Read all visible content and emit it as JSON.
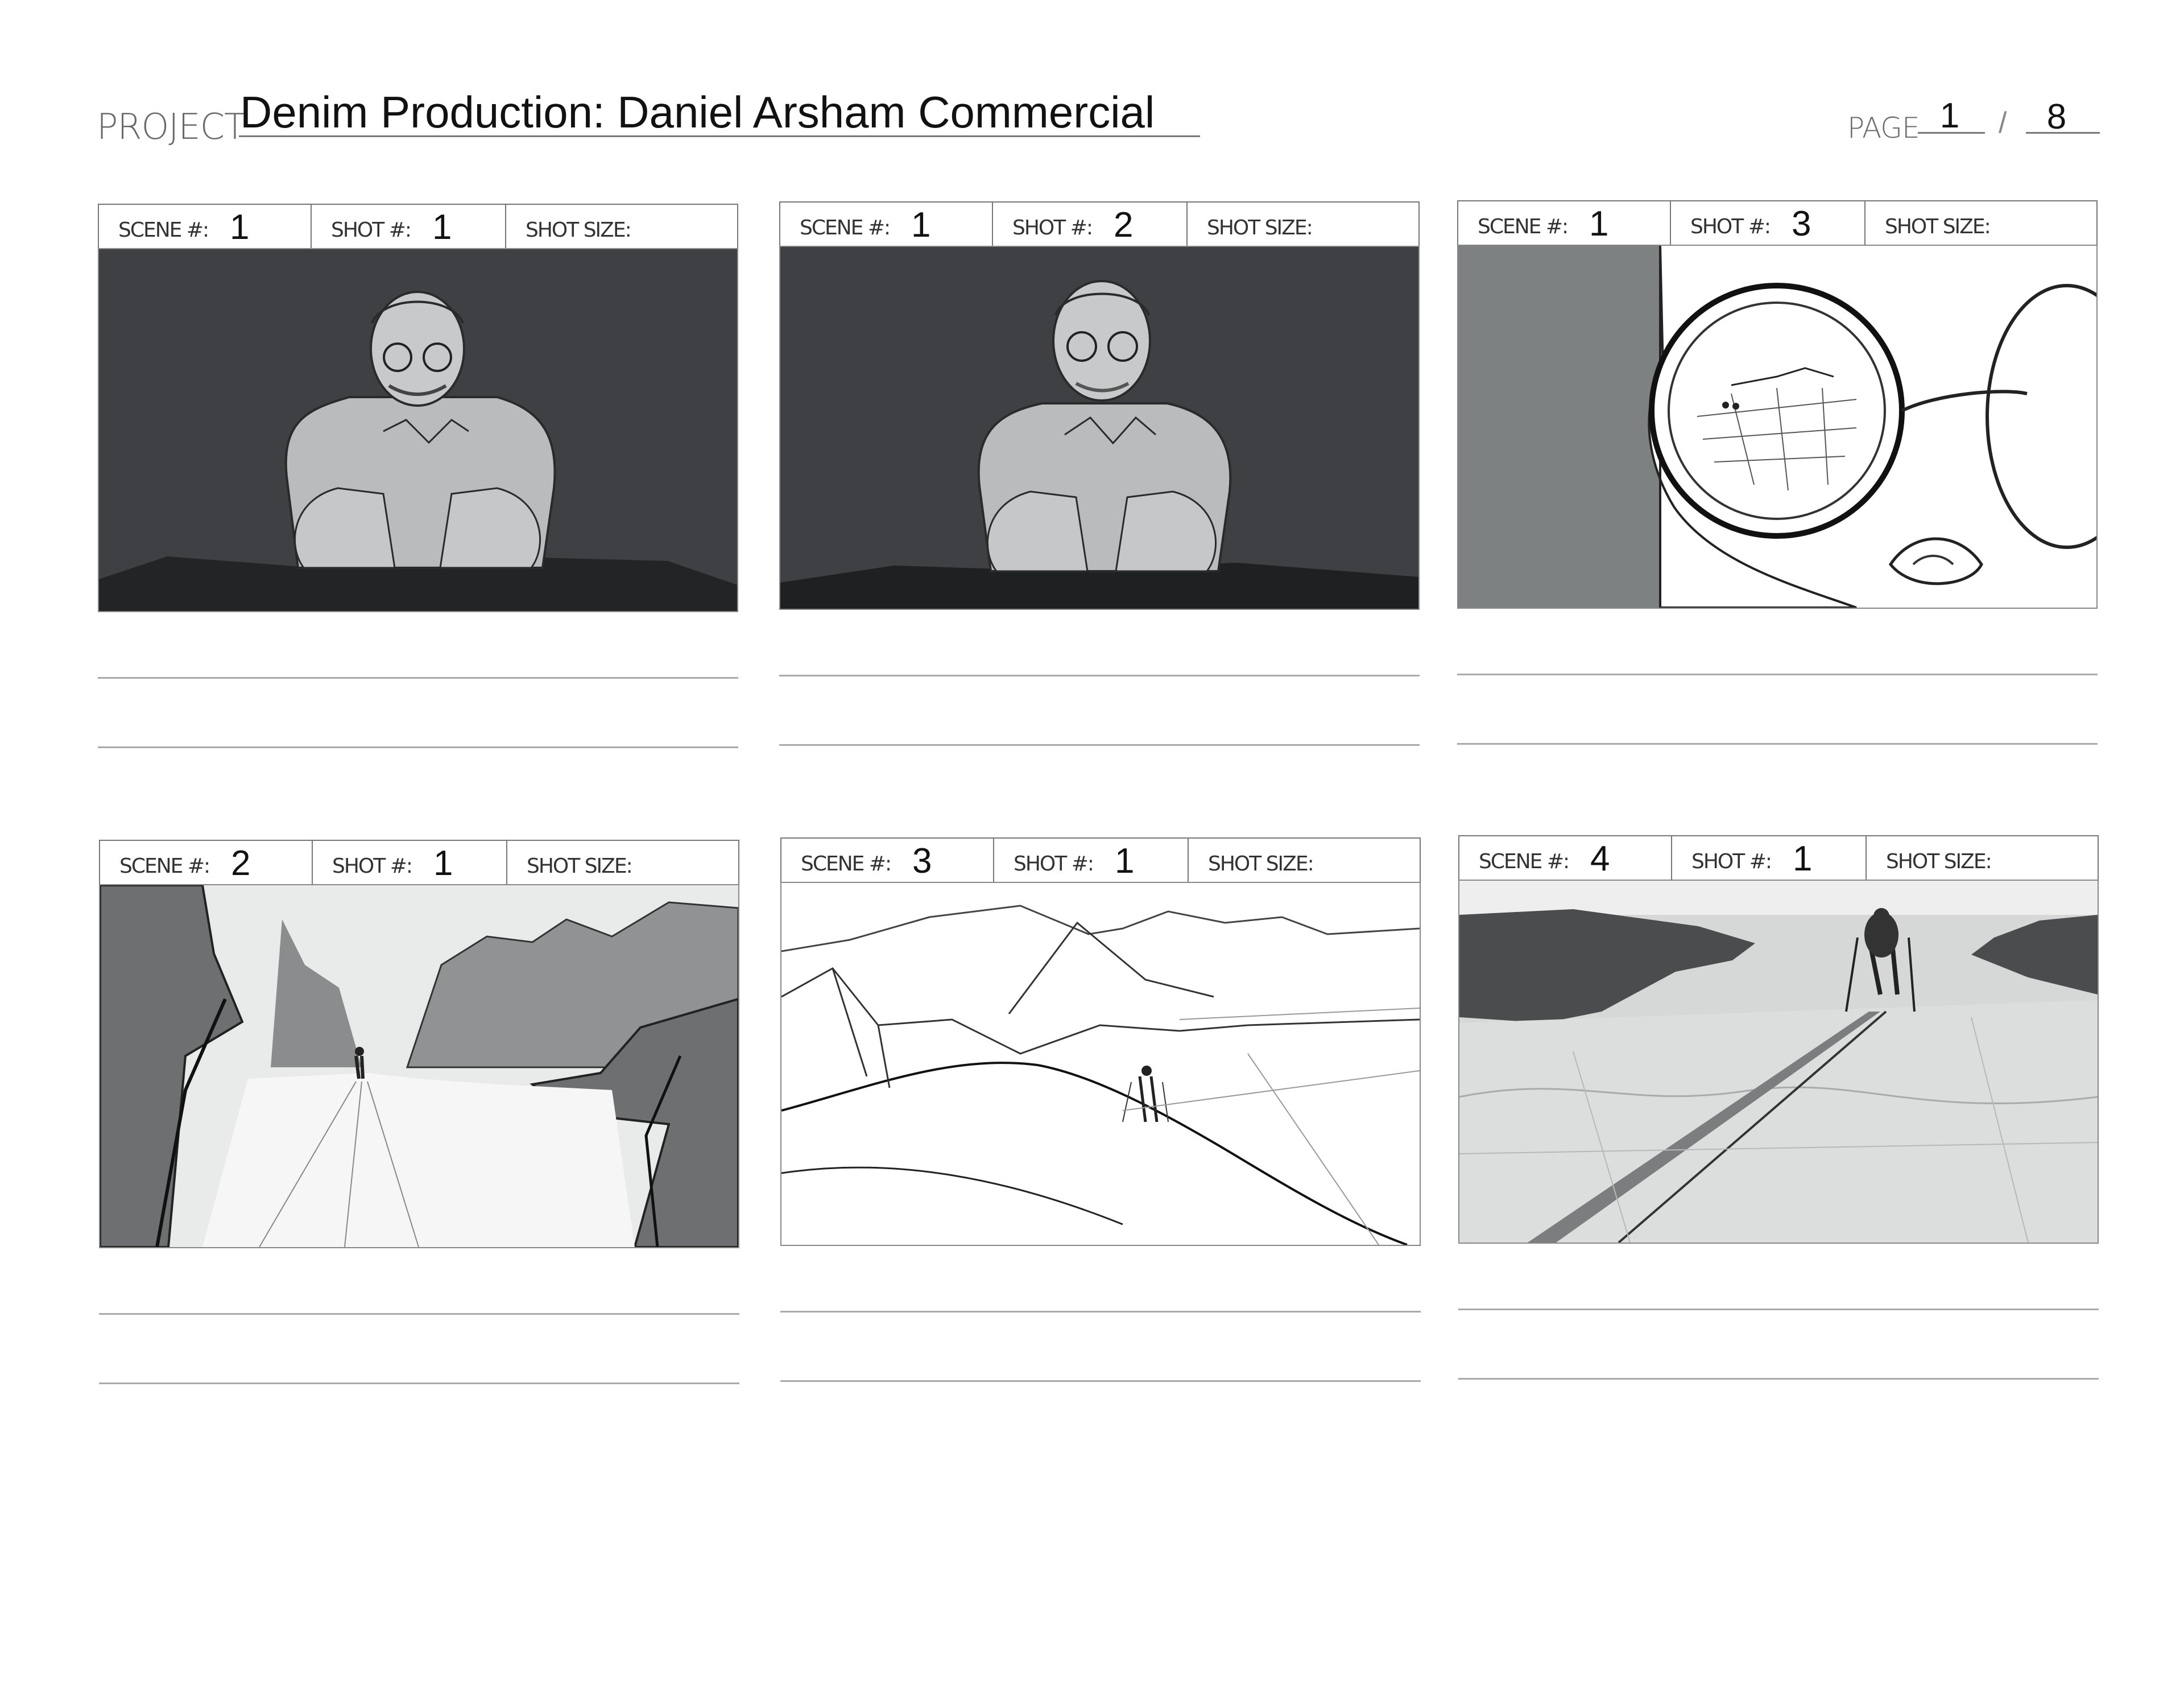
{
  "header": {
    "project_label": "PROJECT",
    "project_title": "Denim Production: Daniel Arsham Commercial",
    "page_label": "PAGE",
    "page_current": "1",
    "page_separator": "/",
    "page_total": "8"
  },
  "labels": {
    "scene": "SCENE #:",
    "shot": "SHOT #:",
    "shot_size": "SHOT SIZE:"
  },
  "panels": [
    {
      "scene": "1",
      "shot": "1",
      "shot_size": "",
      "image_icon": "man-seated-chin-on-hands-sketch"
    },
    {
      "scene": "1",
      "shot": "2",
      "shot_size": "",
      "image_icon": "man-seated-chin-on-hands-closer-sketch"
    },
    {
      "scene": "1",
      "shot": "3",
      "shot_size": "",
      "image_icon": "glasses-closeup-reflection-sketch"
    },
    {
      "scene": "2",
      "shot": "1",
      "shot_size": "",
      "image_icon": "canyon-road-figure-sketch"
    },
    {
      "scene": "3",
      "shot": "1",
      "shot_size": "",
      "image_icon": "snowy-dunes-hiker-sketch"
    },
    {
      "scene": "4",
      "shot": "1",
      "shot_size": "",
      "image_icon": "desert-walker-with-poles-sketch"
    }
  ]
}
